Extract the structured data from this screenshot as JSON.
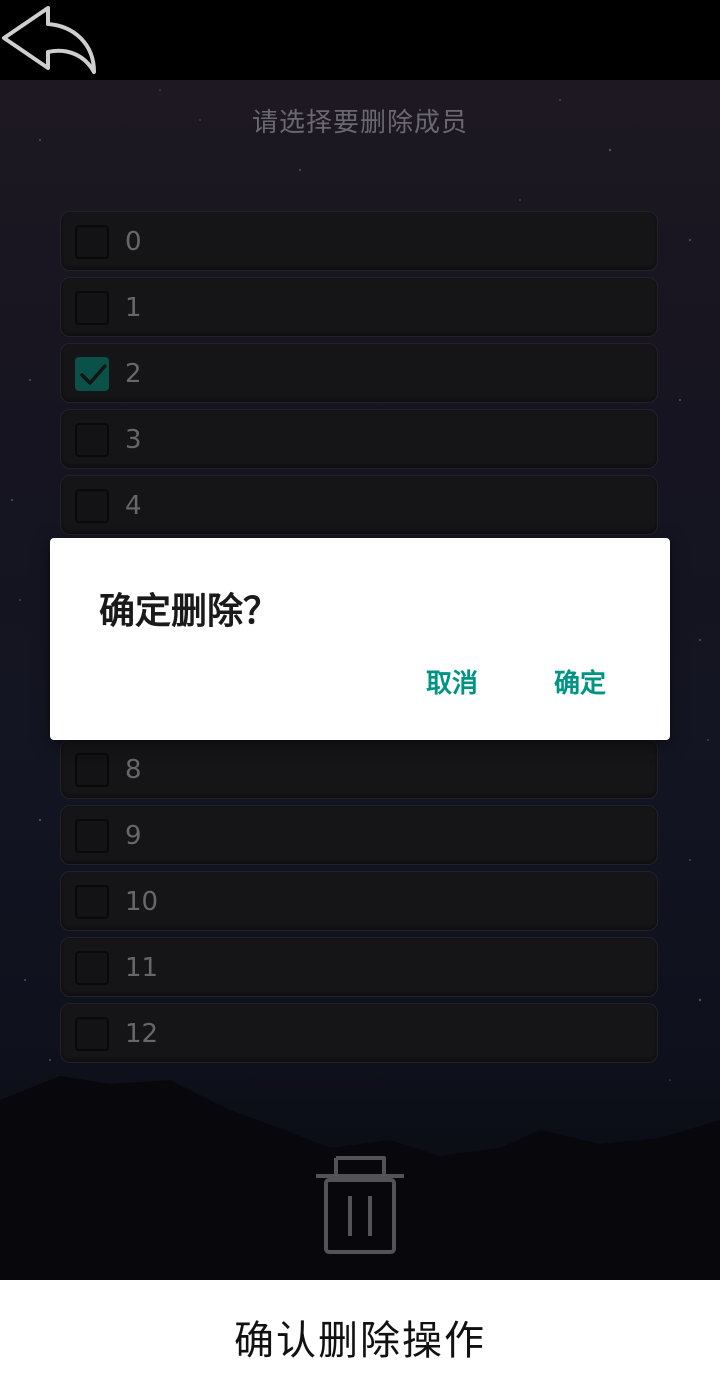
{
  "header": {
    "back_icon": "back-arrow-icon"
  },
  "screen": {
    "title": "请选择要删除成员",
    "members": [
      {
        "label": "0",
        "checked": false
      },
      {
        "label": "1",
        "checked": false
      },
      {
        "label": "2",
        "checked": true
      },
      {
        "label": "3",
        "checked": false
      },
      {
        "label": "4",
        "checked": false
      },
      {
        "label": "8",
        "checked": false
      },
      {
        "label": "9",
        "checked": false
      },
      {
        "label": "10",
        "checked": false
      },
      {
        "label": "11",
        "checked": false
      },
      {
        "label": "12",
        "checked": false
      }
    ],
    "delete_icon": "trash-icon"
  },
  "dialog": {
    "title": "确定删除？",
    "cancel_label": "取消",
    "confirm_label": "确定"
  },
  "caption": {
    "text": "确认删除操作"
  },
  "colors": {
    "accent": "#009485",
    "checkbox_checked": "#0e6e62",
    "row_bg": "#1d1c20",
    "topbar": "#000000"
  }
}
